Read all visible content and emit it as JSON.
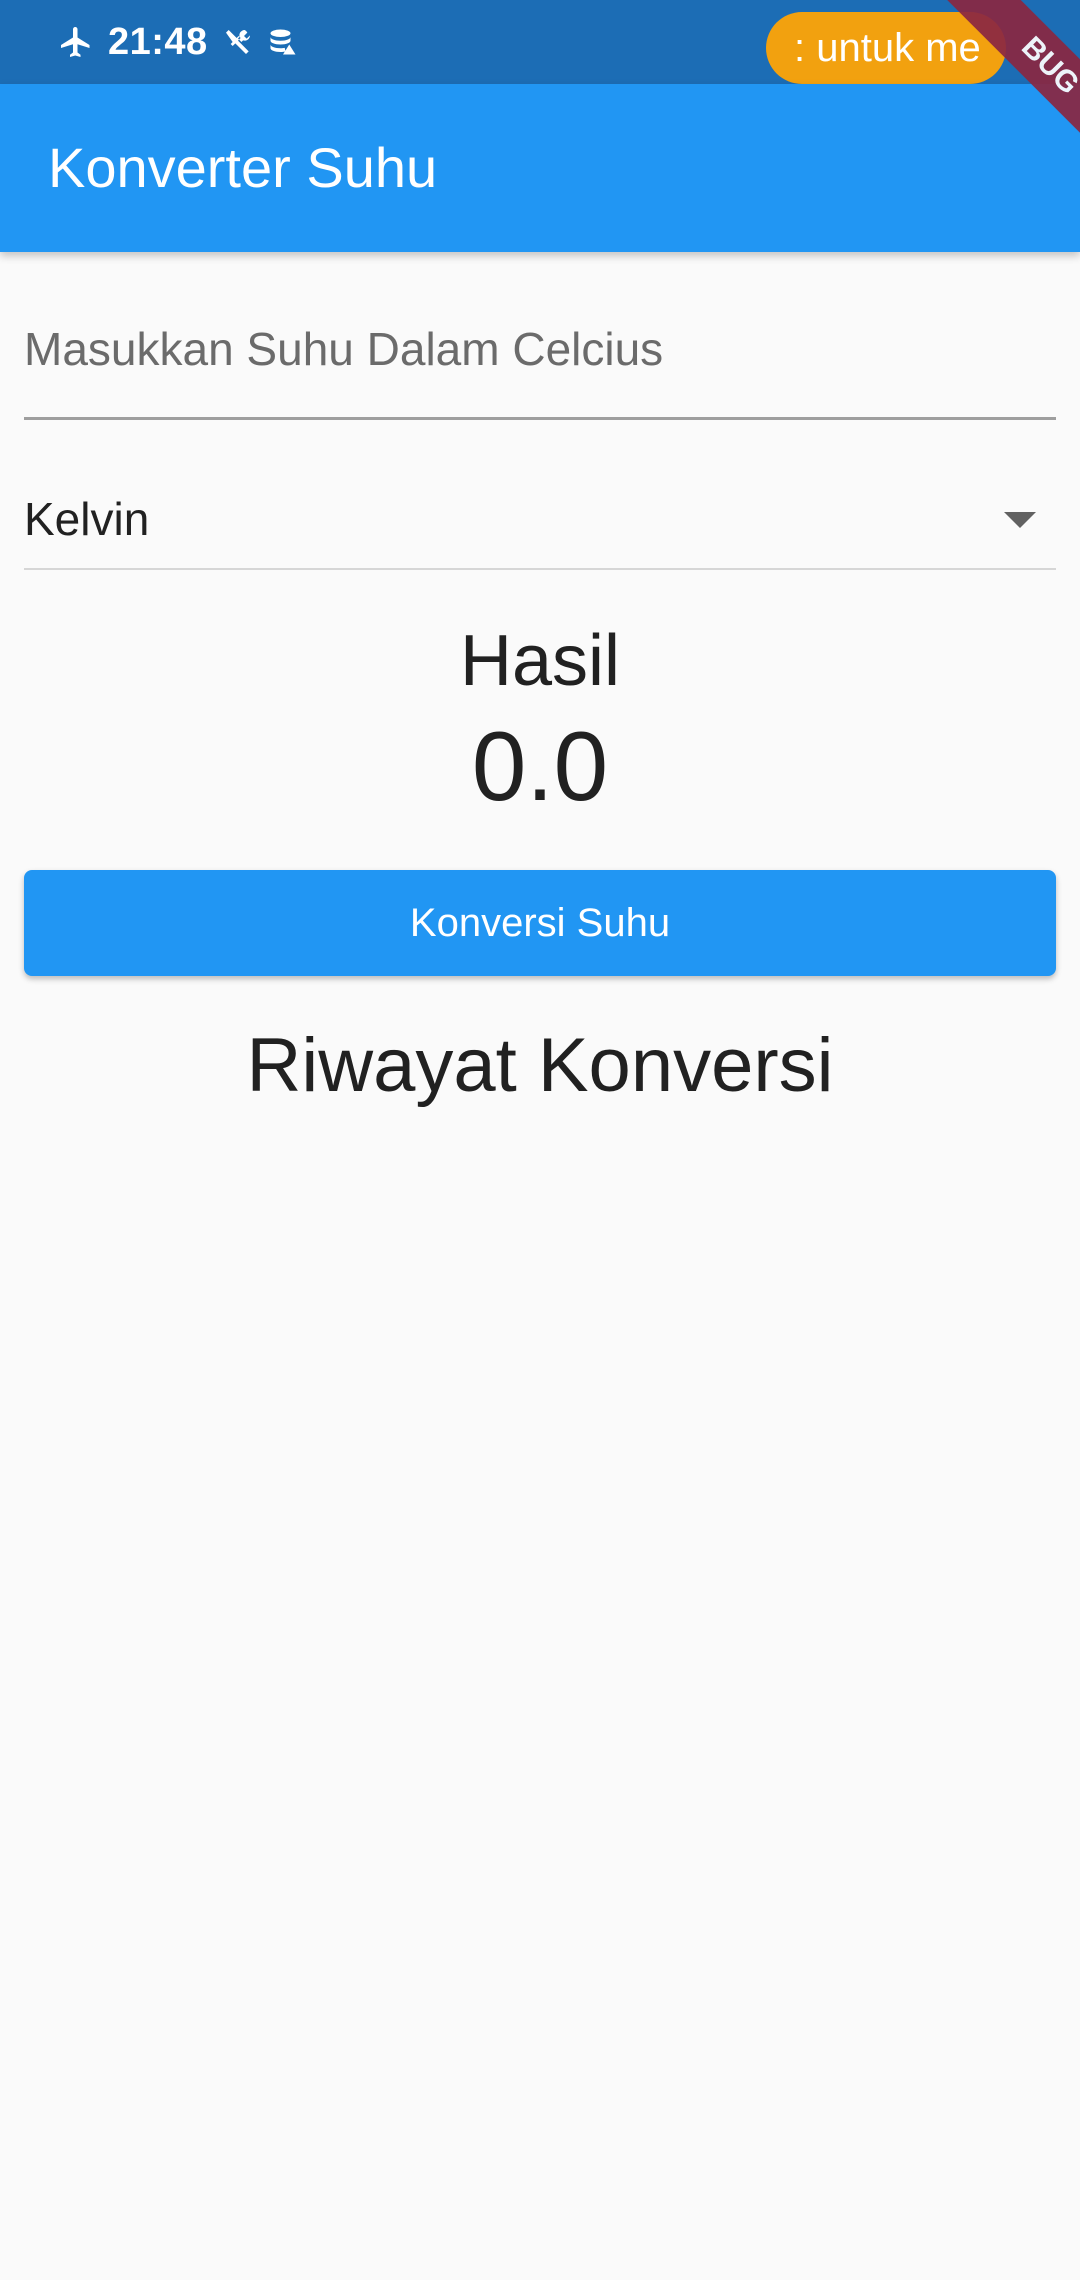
{
  "status_bar": {
    "time": "21:48",
    "icons": [
      "airplane-icon",
      "tools-icon",
      "storage-icon"
    ],
    "notification_pill": ": untuk me"
  },
  "debug_banner": {
    "label": "BUG"
  },
  "app_bar": {
    "title": "Konverter Suhu"
  },
  "form": {
    "temperature_input": {
      "value": "",
      "placeholder": "Masukkan Suhu Dalam Celcius"
    },
    "unit_dropdown": {
      "selected": "Kelvin"
    }
  },
  "result": {
    "label": "Hasil",
    "value": "0.0"
  },
  "convert_button": {
    "label": "Konversi Suhu"
  },
  "history": {
    "title": "Riwayat Konversi",
    "items": []
  },
  "colors": {
    "primary": "#2196f3",
    "status_bar": "#1c6db5",
    "pill": "#f2a10f",
    "debug_banner": "#8a2742",
    "background": "#fafafa"
  }
}
